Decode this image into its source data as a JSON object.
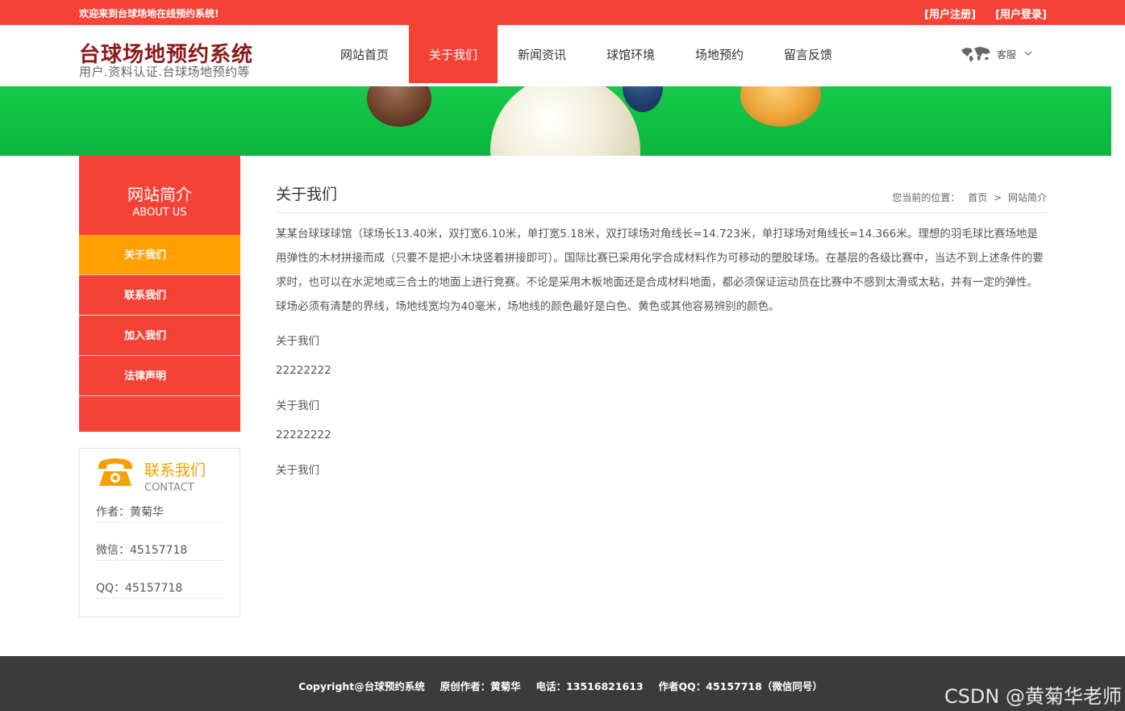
{
  "topbar": {
    "welcome": "欢迎来到台球场地在线预约系统!",
    "register": "[用户注册]",
    "login": "[用户登录]"
  },
  "header": {
    "logo_title": "台球场地预约系统",
    "logo_sub": "用户.资料认证.台球场地预约等",
    "nav": [
      {
        "label": "网站首页"
      },
      {
        "label": "关于我们"
      },
      {
        "label": "新闻资讯"
      },
      {
        "label": "球馆环境"
      },
      {
        "label": "场地预约"
      },
      {
        "label": "留言反馈"
      }
    ],
    "service_label": "客服"
  },
  "sidebar": {
    "title_cn": "网站简介",
    "title_en": "ABOUT US",
    "items": [
      {
        "label": "关于我们"
      },
      {
        "label": "联系我们"
      },
      {
        "label": "加入我们"
      },
      {
        "label": "法律声明"
      }
    ]
  },
  "contact": {
    "title_cn": "联系我们",
    "title_en": "CONTACT",
    "author": "作者：黄菊华",
    "wechat": "微信：45157718",
    "qq": "QQ：45157718"
  },
  "content": {
    "title": "关于我们",
    "breadcrumb_label": "您当前的位置：",
    "breadcrumb_home": "首页",
    "breadcrumb_sep": ">",
    "breadcrumb_current": "网站简介",
    "paragraph": "某某台球球球馆（球场长13.40米，双打宽6.10米，单打宽5.18米，双打球场对角线长=14.723米，单打球场对角线长=14.366米。理想的羽毛球比赛场地是用弹性的木材拼接而成（只要不是把小木块竖着拼接即可）。国际比赛已采用化学合成材料作为可移动的塑胶球场。在基层的各级比赛中，当达不到上述条件的要求时，也可以在水泥地或三合土的地面上进行竞赛。不论是采用木板地面还是合成材料地面，都必须保证运动员在比赛中不感到太滑或太粘，并有一定的弹性。球场必须有清楚的界线，场地线宽均为40毫米，场地线的颜色最好是白色、黄色或其他容易辨别的颜色。",
    "lines": [
      "关于我们",
      "22222222",
      "关于我们",
      "22222222",
      "关于我们"
    ]
  },
  "footer": {
    "copyright": "Copyright@台球预约系统　 原创作者：黄菊华　 电话：13516821613　 作者QQ：45157718（微信同号）",
    "watermark": "CSDN @黄菊华老师"
  },
  "colors": {
    "primary": "#f44336",
    "accent": "#ff9f00",
    "banner_green": "#0fc043",
    "footer_bg": "#3b3b3b"
  },
  "icons": {
    "service": "world-map-icon",
    "dropdown": "chevron-down-icon",
    "contact": "telephone-icon"
  }
}
